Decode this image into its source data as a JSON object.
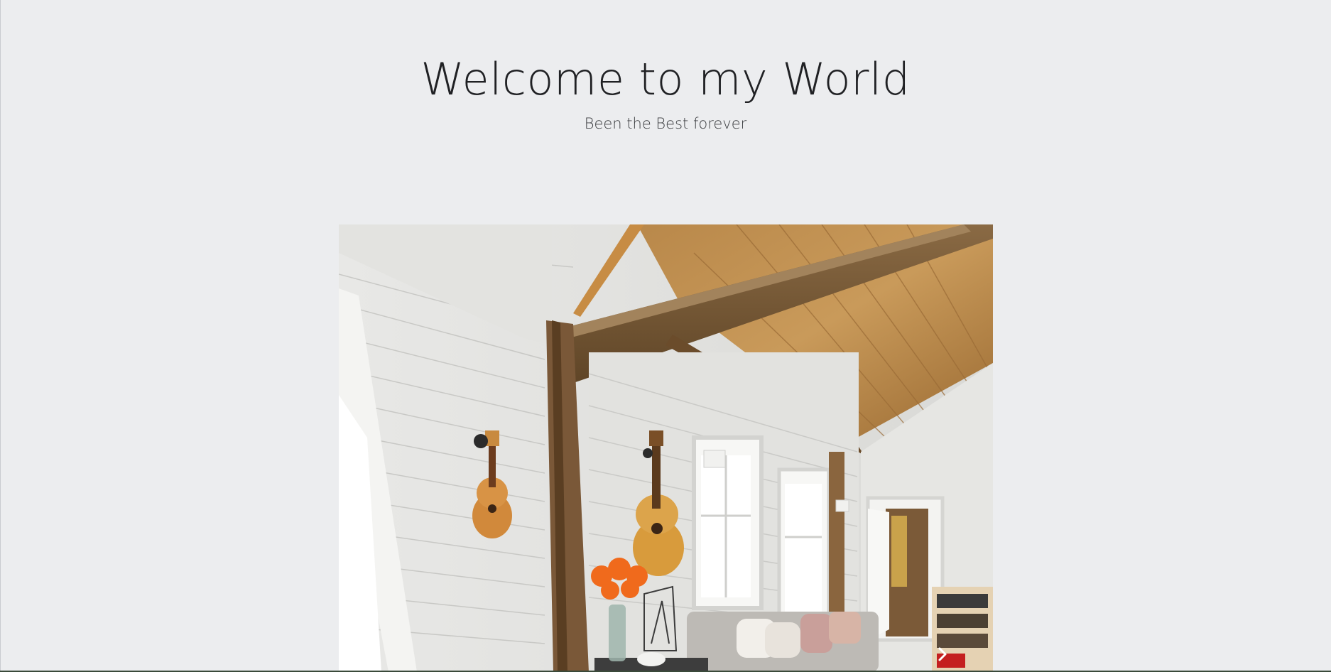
{
  "hero": {
    "title": "Welcome to my World",
    "subtitle": "Been the Best forever"
  },
  "carousel": {
    "next_icon": "chevron-right-icon",
    "image_subject": "living room photo"
  },
  "colors": {
    "background": "#ecedef",
    "text": "#202124"
  }
}
